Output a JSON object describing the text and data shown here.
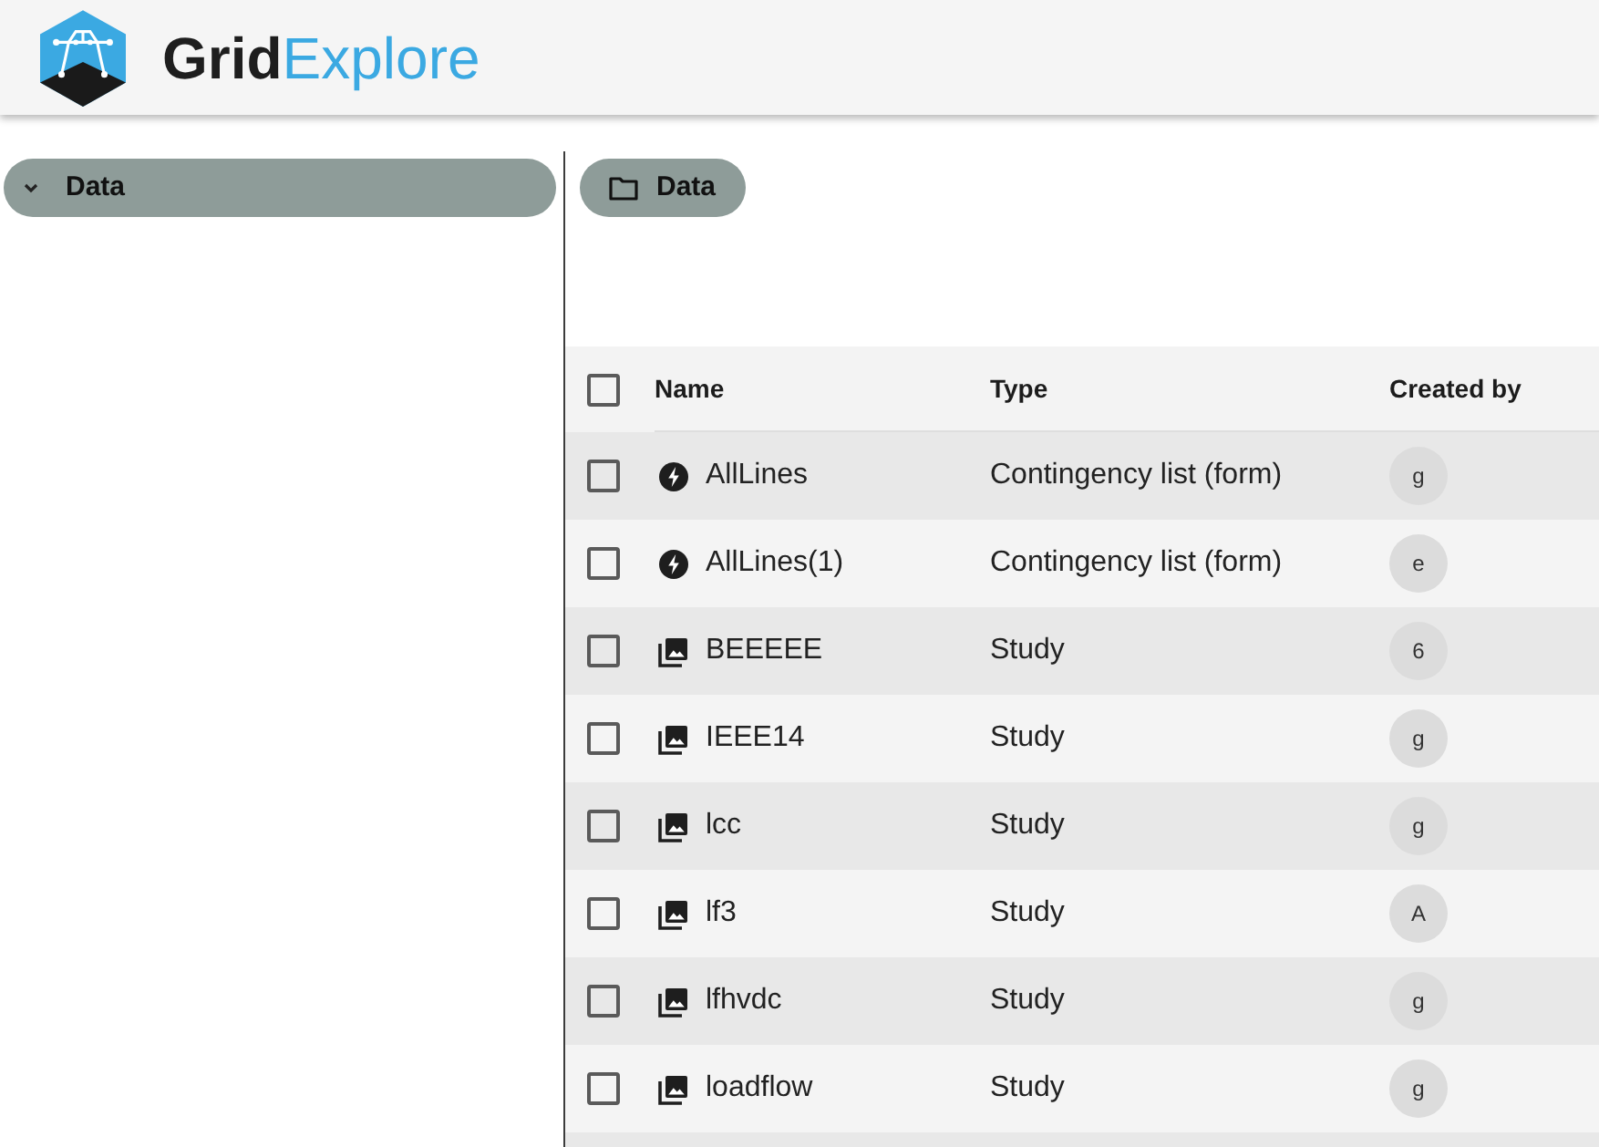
{
  "app_title": {
    "dark_part": "Grid",
    "accent_part": "Explore"
  },
  "tree": [
    {
      "label": "Data",
      "expanded": true,
      "selected": true
    }
  ],
  "breadcrumb": [
    {
      "label": "Data"
    }
  ],
  "table": {
    "select_all": {
      "checked": false
    },
    "columns": [
      "Name",
      "Type",
      "Created by"
    ],
    "rows": [
      {
        "kind": "contingency",
        "name": "AllLines",
        "type": "Contingency list (form)",
        "created_by": "g",
        "checked": false
      },
      {
        "kind": "contingency",
        "name": "AllLines(1)",
        "type": "Contingency list (form)",
        "created_by": "e",
        "checked": false
      },
      {
        "kind": "study",
        "name": "BEEEEE",
        "type": "Study",
        "created_by": "6",
        "checked": false
      },
      {
        "kind": "study",
        "name": "IEEE14",
        "type": "Study",
        "created_by": "g",
        "checked": false
      },
      {
        "kind": "study",
        "name": "lcc",
        "type": "Study",
        "created_by": "g",
        "checked": false
      },
      {
        "kind": "study",
        "name": "lf3",
        "type": "Study",
        "created_by": "A",
        "checked": false
      },
      {
        "kind": "study",
        "name": "lfhvdc",
        "type": "Study",
        "created_by": "g",
        "checked": false
      },
      {
        "kind": "study",
        "name": "loadflow",
        "type": "Study",
        "created_by": "g",
        "checked": false
      }
    ]
  }
}
